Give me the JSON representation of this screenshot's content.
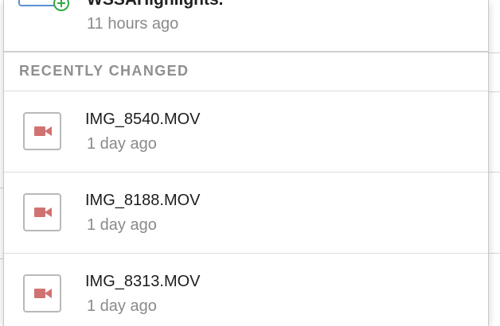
{
  "top_item": {
    "title": "WSSAHighlights.",
    "time": "11 hours ago"
  },
  "section": {
    "title": "RECENTLY CHANGED"
  },
  "files": [
    {
      "name": "IMG_8540.MOV",
      "time": "1 day ago",
      "icon": "video-camera-icon"
    },
    {
      "name": "IMG_8188.MOV",
      "time": "1 day ago",
      "icon": "video-camera-icon"
    },
    {
      "name": "IMG_8313.MOV",
      "time": "1 day ago",
      "icon": "video-camera-icon"
    }
  ],
  "colors": {
    "video_icon": "#d17272",
    "add_badge": "#2faa3f",
    "folder_outline": "#5a8fd8",
    "secondary_text": "#8a8a8a"
  }
}
